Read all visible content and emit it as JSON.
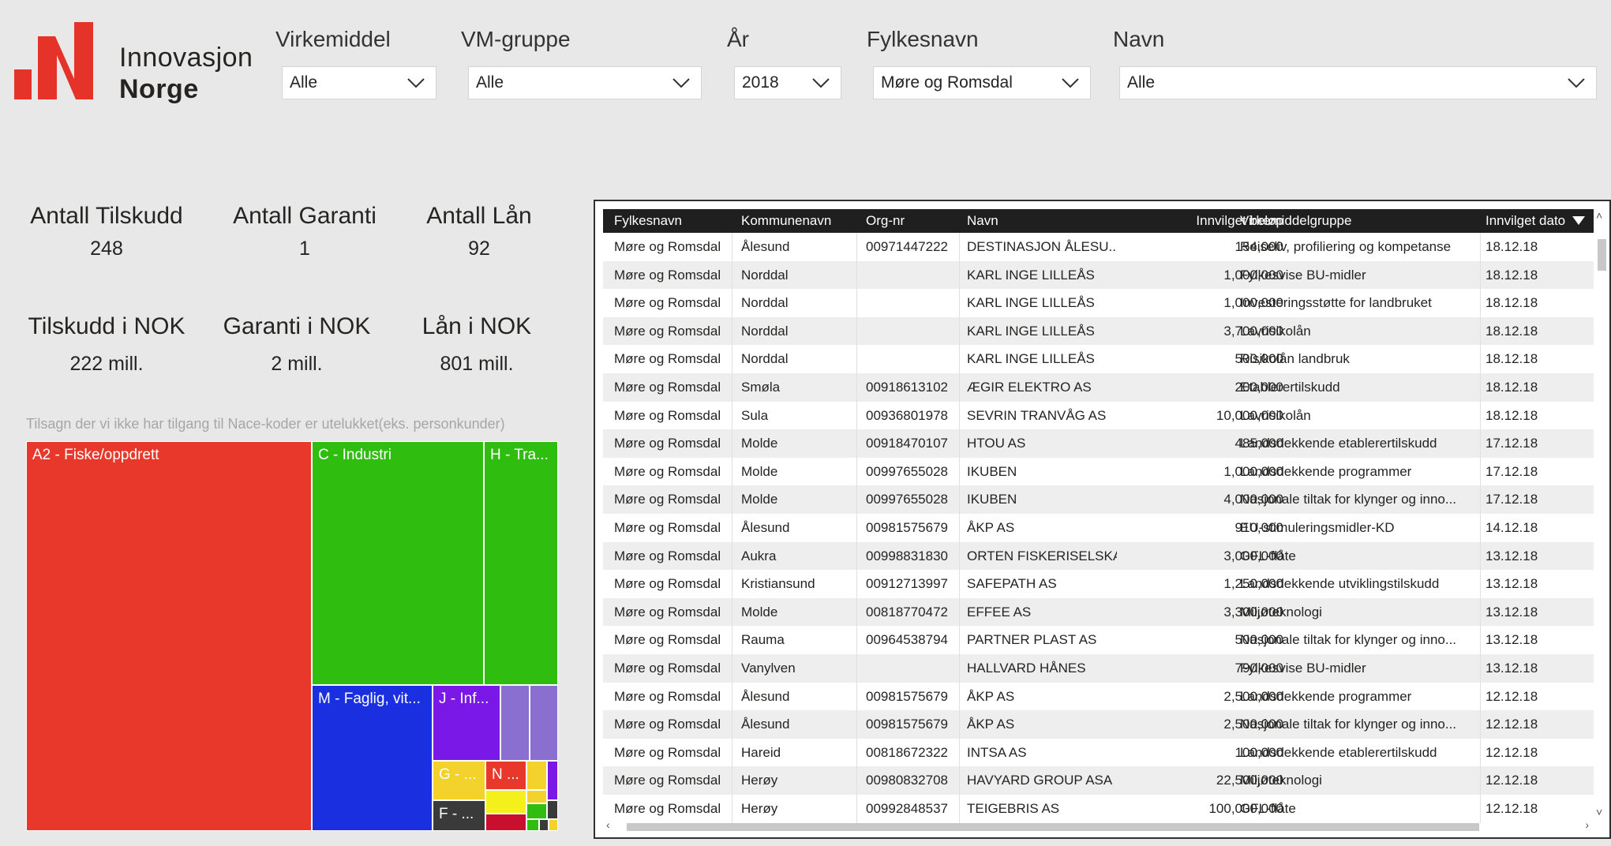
{
  "brand": {
    "line1": "Innovasjon",
    "line2": "Norge",
    "color": "#e63329"
  },
  "slicers": [
    {
      "title": "Virkemiddel",
      "value": "Alle"
    },
    {
      "title": "VM-gruppe",
      "value": "Alle"
    },
    {
      "title": "År",
      "value": "2018"
    },
    {
      "title": "Fylkesnavn",
      "value": "Møre og Romsdal"
    },
    {
      "title": "Navn",
      "value": "Alle"
    }
  ],
  "kpis": [
    {
      "label": "Antall Tilskudd",
      "value": "248"
    },
    {
      "label": "Antall Garanti",
      "value": "1"
    },
    {
      "label": "Antall Lån",
      "value": "92"
    },
    {
      "label": "Tilskudd i NOK",
      "value": "222 mill."
    },
    {
      "label": "Garanti i NOK",
      "value": "2 mill."
    },
    {
      "label": "Lån i NOK",
      "value": "801 mill."
    }
  ],
  "note": "Tilsagn der vi ikke har tilgang til Nace-koder er utelukket(eks. personkunder)",
  "treemap": {
    "colors": {
      "red": "#e8382b",
      "green": "#2fbd10",
      "blue": "#1a2fe0",
      "purple": "#7a18e8",
      "lavender": "#8a6fd0",
      "yellow": "#f3d22b",
      "dark": "#3a3a3a",
      "crimson": "#c8102e"
    },
    "labels": [
      "A2 - Fiske/oppdrett",
      "C - Industri",
      "H - Tra...",
      "M - Faglig, vit...",
      "J - Inf...",
      "G - ...",
      "N ...",
      "F - ..."
    ]
  },
  "table": {
    "columns": [
      "Fylkesnavn",
      "Kommunenavn",
      "Org-nr",
      "Navn",
      "Innvilget beløp",
      "Virkemiddelgruppe",
      "Innvilget dato"
    ],
    "rows": [
      [
        "Møre og Romsdal",
        "Ålesund",
        "00971447222",
        "DESTINASJON ÅLESU...",
        "154,000",
        "Reiseliv, profiliering og kompetanse",
        "18.12.18"
      ],
      [
        "Møre og Romsdal",
        "Norddal",
        "",
        "KARL INGE LILLEÅS",
        "1,000,000",
        "Fylkesvise BU-midler",
        "18.12.18"
      ],
      [
        "Møre og Romsdal",
        "Norddal",
        "",
        "KARL INGE LILLEÅS",
        "1,000,000",
        "Investeringsstøtte for landbruket",
        "18.12.18"
      ],
      [
        "Møre og Romsdal",
        "Norddal",
        "",
        "KARL INGE LILLEÅS",
        "3,700,000",
        "Lavrisikolån",
        "18.12.18"
      ],
      [
        "Møre og Romsdal",
        "Norddal",
        "",
        "KARL INGE LILLEÅS",
        "500,000",
        "Risikolån landbruk",
        "18.12.18"
      ],
      [
        "Møre og Romsdal",
        "Smøla",
        "00918613102",
        "ÆGIR ELEKTRO AS",
        "200,000",
        "Etablerertilskudd",
        "18.12.18"
      ],
      [
        "Møre og Romsdal",
        "Sula",
        "00936801978",
        "SEVRIN TRANVÅG AS",
        "10,000,000",
        "Lavrisikolån",
        "18.12.18"
      ],
      [
        "Møre og Romsdal",
        "Molde",
        "00918470107",
        "HTOU AS",
        "485,000",
        "Landsdekkende etablerertilskudd",
        "17.12.18"
      ],
      [
        "Møre og Romsdal",
        "Molde",
        "00997655028",
        "IKUBEN",
        "1,000,000",
        "Landsdekkende programmer",
        "17.12.18"
      ],
      [
        "Møre og Romsdal",
        "Molde",
        "00997655028",
        "IKUBEN",
        "4,000,000",
        "Nasjonale tiltak for klynger og inno...",
        "17.12.18"
      ],
      [
        "Møre og Romsdal",
        "Ålesund",
        "00981575679",
        "ÅKP AS",
        "910,000",
        "EU-stimuleringsmidler-KD",
        "14.12.18"
      ],
      [
        "Møre og Romsdal",
        "Aukra",
        "00998831830",
        "ORTEN FISKERISELSKA...",
        "3,000,000",
        "GFL-flåte",
        "13.12.18"
      ],
      [
        "Møre og Romsdal",
        "Kristiansund",
        "00912713997",
        "SAFEPATH AS",
        "1,250,000",
        "Landsdekkende utviklingstilskudd",
        "13.12.18"
      ],
      [
        "Møre og Romsdal",
        "Molde",
        "00818770472",
        "EFFEE AS",
        "3,300,000",
        "Miljøteknologi",
        "13.12.18"
      ],
      [
        "Møre og Romsdal",
        "Rauma",
        "00964538794",
        "PARTNER PLAST AS",
        "500,000",
        "Nasjonale tiltak for klynger og inno...",
        "13.12.18"
      ],
      [
        "Møre og Romsdal",
        "Vanylven",
        "",
        "HALLVARD HÅNES",
        "790,000",
        "Fylkesvise BU-midler",
        "13.12.18"
      ],
      [
        "Møre og Romsdal",
        "Ålesund",
        "00981575679",
        "ÅKP AS",
        "2,500,000",
        "Landsdekkende programmer",
        "12.12.18"
      ],
      [
        "Møre og Romsdal",
        "Ålesund",
        "00981575679",
        "ÅKP AS",
        "2,500,000",
        "Nasjonale tiltak for klynger og inno...",
        "12.12.18"
      ],
      [
        "Møre og Romsdal",
        "Hareid",
        "00818672322",
        "INTSA AS",
        "100,000",
        "Landsdekkende etablerertilskudd",
        "12.12.18"
      ],
      [
        "Møre og Romsdal",
        "Herøy",
        "00980832708",
        "HAVYARD GROUP ASA",
        "22,500,000",
        "Miljøteknologi",
        "12.12.18"
      ],
      [
        "Møre og Romsdal",
        "Herøy",
        "00992848537",
        "TEIGEBRIS AS",
        "100,000,000",
        "GFL-flåte",
        "12.12.18"
      ]
    ]
  }
}
